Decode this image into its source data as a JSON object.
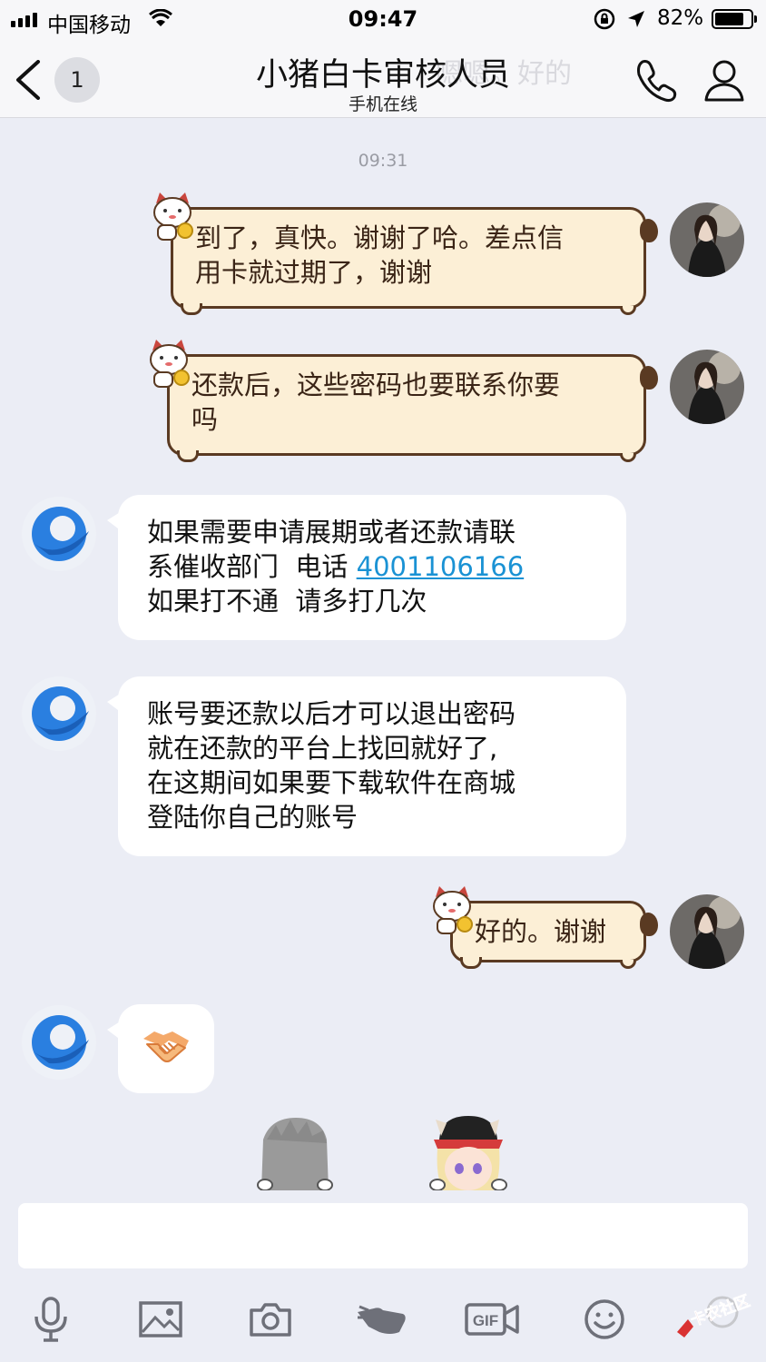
{
  "status_bar": {
    "carrier": "中国移动",
    "time": "09:47",
    "battery_pct": "82%",
    "battery_level": 0.82
  },
  "nav": {
    "back_count": "1",
    "title": "小猪白卡审核人员",
    "subtitle": "手机在线",
    "ghost_text": "嗯嗯。好的"
  },
  "chat": {
    "timestamp": "09:31",
    "messages": [
      {
        "side": "right",
        "lines": [
          "到了，真快。谢谢了哈。差点信",
          "用卡就过期了，谢谢"
        ]
      },
      {
        "side": "right",
        "lines": [
          "还款后，这些密码也要联系你要",
          "吗"
        ]
      },
      {
        "side": "left",
        "line1": "如果需要申请展期或者还款请联",
        "line2_prefix": "系催收部门  电话 ",
        "phone": "4001106166",
        "line3": "如果打不通  请多打几次"
      },
      {
        "side": "left",
        "lines": [
          "账号要还款以后才可以退出密码",
          "就在还款的平台上找回就好了,",
          "在这期间如果要下载软件在商城",
          "登陆你自己的账号"
        ]
      },
      {
        "side": "right",
        "lines": [
          "好的。谢谢"
        ]
      },
      {
        "side": "left",
        "emoji": "handshake"
      }
    ]
  },
  "toolbar": {
    "items": [
      "microphone-icon",
      "image-icon",
      "camera-icon",
      "poke-icon",
      "gif-icon",
      "emoji-icon"
    ],
    "gif_label": "GIF"
  },
  "watermark": {
    "text": "卡农社区"
  },
  "colors": {
    "background": "#ebedf5",
    "cat_bubble_fill": "#fcefd6",
    "cat_bubble_border": "#5a3a22",
    "link": "#1a92d4",
    "bot_avatar_blue": "#2a7fe0"
  }
}
